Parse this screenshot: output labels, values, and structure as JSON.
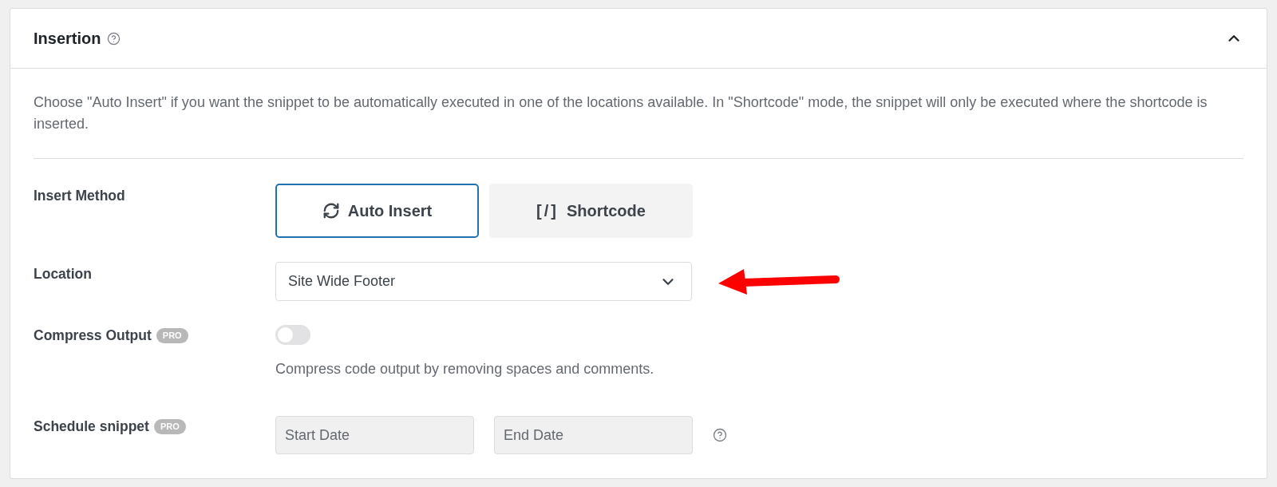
{
  "panel": {
    "title": "Insertion",
    "expanded": true
  },
  "description": "Choose \"Auto Insert\" if you want the snippet to be automatically executed in one of the locations available. In \"Shortcode\" mode, the snippet will only be executed where the shortcode is inserted.",
  "fields": [
    {
      "kind": "choice",
      "label": "Insert Method",
      "options": [
        {
          "label": "Auto Insert",
          "selected": true
        },
        {
          "label": "Shortcode",
          "glyph": "[/]",
          "selected": false
        }
      ]
    },
    {
      "kind": "select",
      "label": "Location",
      "value": "Site Wide Footer"
    },
    {
      "kind": "toggle",
      "label": "Compress Output",
      "badge": "PRO",
      "on": false,
      "help_text": "Compress code output by removing spaces and comments."
    },
    {
      "kind": "date_range",
      "label": "Schedule snippet",
      "badge": "PRO",
      "inputs": [
        {
          "placeholder": "Start Date",
          "disabled": true
        },
        {
          "placeholder": "End Date",
          "disabled": true
        }
      ]
    }
  ]
}
